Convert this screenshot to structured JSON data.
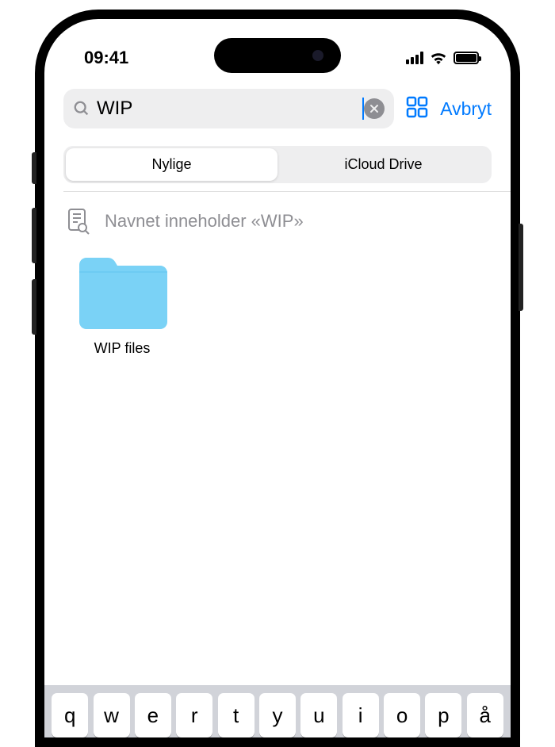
{
  "status_bar": {
    "time": "09:41"
  },
  "search": {
    "value": "WIP",
    "cancel_label": "Avbryt"
  },
  "tabs": {
    "recent_label": "Nylige",
    "icloud_label": "iCloud Drive"
  },
  "suggestion": {
    "text": "Navnet inneholder «WIP»"
  },
  "results": {
    "folder_name": "WIP files"
  },
  "keyboard": {
    "keys": [
      "q",
      "w",
      "e",
      "r",
      "t",
      "y",
      "u",
      "i",
      "o",
      "p",
      "å"
    ]
  },
  "colors": {
    "accent": "#007aff",
    "folder": "#7ad2f6"
  }
}
